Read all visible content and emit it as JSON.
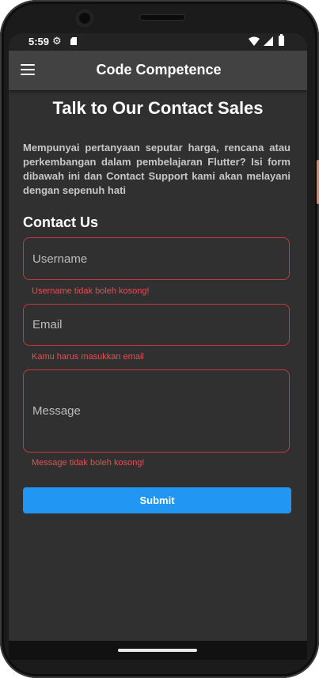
{
  "status_bar": {
    "time": "5:59",
    "icons": [
      "gear-icon",
      "sim-card-icon",
      "wifi-icon",
      "signal-icon",
      "battery-icon"
    ]
  },
  "app_bar": {
    "title": "Code Competence",
    "menu_icon": "hamburger-menu-icon"
  },
  "page": {
    "title": "Talk to Our Contact Sales",
    "intro": "Mempunyai pertanyaan seputar harga, rencana atau perkembangan dalam pembelajaran Flutter? Isi form dibawah ini dan Contact Support kami akan melayani dengan sepenuh hati"
  },
  "form": {
    "section_title": "Contact Us",
    "username": {
      "placeholder": "Username",
      "value": "",
      "error": "Username tidak boleh kosong!"
    },
    "email": {
      "placeholder": "Email",
      "value": "",
      "error": "Kamu harus masukkan email"
    },
    "message": {
      "placeholder": "Message",
      "value": "",
      "error": "Message tidak boleh kosong!"
    },
    "submit_label": "Submit"
  },
  "colors": {
    "background": "#303030",
    "app_bar": "#424242",
    "error": "#e05252",
    "accent": "#2196f3"
  }
}
